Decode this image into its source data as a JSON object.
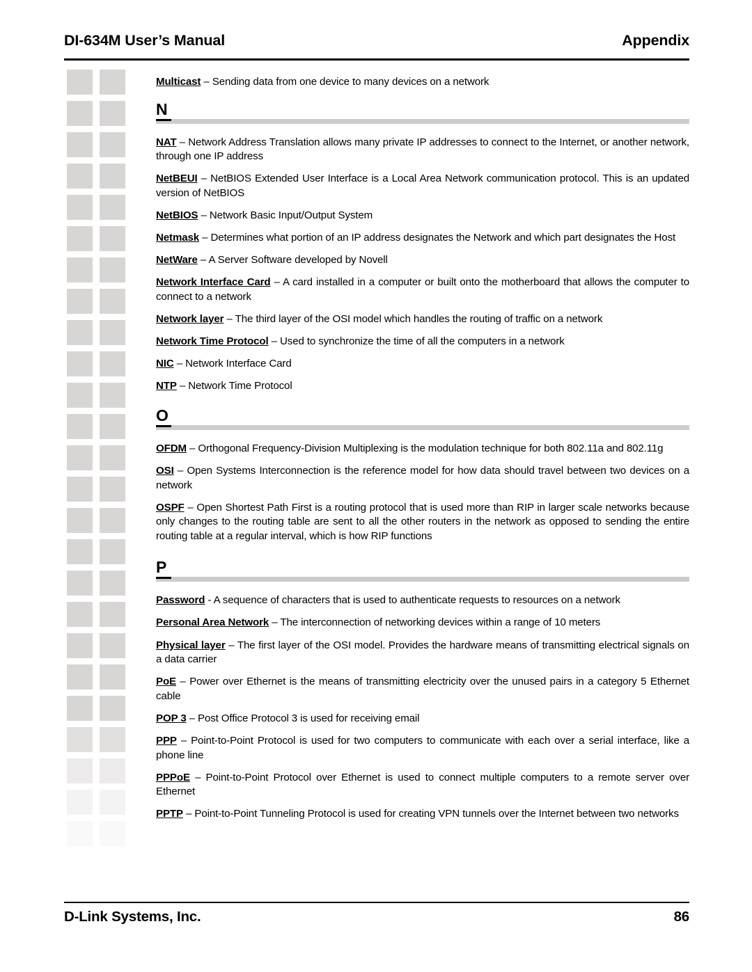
{
  "header": {
    "title": "DI-634M User’s Manual",
    "section": "Appendix"
  },
  "footer": {
    "company": "D-Link Systems, Inc.",
    "page_number": "86"
  },
  "colors": {
    "rule_black": "#000000",
    "section_rule_gray": "#cccccc",
    "deco_square": "#d8d6d5",
    "page_background": "#ffffff",
    "text": "#000000"
  },
  "decoration": {
    "name": "sidebar-square-grid",
    "columns": 2,
    "rows": 25,
    "square_color": "#d8d6d5"
  },
  "content": {
    "lead_entry": {
      "term": "Multicast",
      "dash": " – ",
      "definition": "Sending data from one device to many devices on a network"
    },
    "sections": [
      {
        "letter": "N",
        "entries": [
          {
            "term": "NAT",
            "dash": " – ",
            "definition": "Network Address Translation allows many private IP addresses to connect to the Internet, or another network, through one IP address"
          },
          {
            "term": "NetBEUI",
            "dash": " – ",
            "definition": "NetBIOS Extended User Interface is a Local Area Network communication protocol.  This is an updated version of NetBIOS"
          },
          {
            "term": "NetBIOS",
            "dash": " – ",
            "definition": "Network Basic Input/Output System"
          },
          {
            "term": "Netmask",
            "dash": " – ",
            "definition": "Determines what portion of an IP address designates the Network and which part designates the Host"
          },
          {
            "term": "NetWare",
            "dash": " – ",
            "definition": "A Server Software developed by Novell"
          },
          {
            "term": "Network Interface Card",
            "dash": " – ",
            "definition": "A card installed in a computer or built onto the motherboard that allows the computer to connect to a network"
          },
          {
            "term": "Network layer",
            "dash": " – ",
            "definition": "The third layer of the OSI model which handles the routing of traffic on a network"
          },
          {
            "term": "Network Time Protocol",
            "dash": " – ",
            "definition": "Used to synchronize the time of all the computers in a network"
          },
          {
            "term": "NIC",
            "dash": " – ",
            "definition": "Network Interface Card"
          },
          {
            "term": "NTP",
            "dash": " – ",
            "definition": "Network Time Protocol"
          }
        ]
      },
      {
        "letter": "O",
        "entries": [
          {
            "term": "OFDM",
            "dash": " – ",
            "definition": "Orthogonal Frequency-Division Multiplexing is the modulation technique for both 802.11a and 802.11g"
          },
          {
            "term": "OSI",
            "dash": " – ",
            "definition": "Open Systems Interconnection is the reference model for how data should travel between two devices on a network"
          },
          {
            "term": "OSPF",
            "dash": " – ",
            "definition": "Open Shortest Path First is a routing protocol that is used more than RIP in larger scale networks because only changes to the routing table are sent to all the other routers in the network as opposed to sending the entire routing table at a regular interval, which is how RIP functions"
          }
        ]
      },
      {
        "letter": "P",
        "entries": [
          {
            "term": "Password",
            "dash": " -  ",
            "definition": "A sequence of characters that is used to authenticate requests to resources on a network"
          },
          {
            "term": "Personal Area Network",
            "dash": " – ",
            "definition": "The interconnection of networking devices within a range of 10 meters"
          },
          {
            "term": "Physical layer",
            "dash": " – ",
            "definition": "The first layer of the OSI model.  Provides the hardware means of transmitting electrical signals on a data carrier"
          },
          {
            "term": "PoE",
            "dash": " – ",
            "definition": "Power over Ethernet is the means of transmitting electricity over the unused pairs in a category 5 Ethernet cable"
          },
          {
            "term": "POP 3",
            "dash": " – ",
            "definition": "Post Office Protocol 3 is used for receiving email"
          },
          {
            "term": "PPP",
            "dash": " – ",
            "definition": "Point-to-Point Protocol is used for two computers to communicate with each over a serial interface, like a phone line"
          },
          {
            "term": "PPPoE",
            "dash": " – ",
            "definition": "Point-to-Point Protocol over Ethernet is used to connect multiple computers to a remote server over Ethernet"
          },
          {
            "term": "PPTP",
            "dash": " – ",
            "definition": "Point-to-Point Tunneling Protocol is used for creating VPN tunnels over the Internet between two networks"
          }
        ]
      }
    ]
  }
}
